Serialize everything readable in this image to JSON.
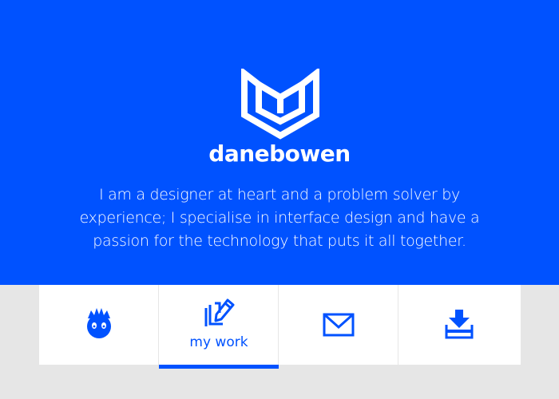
{
  "brand": {
    "name": "danebowen",
    "logo_icon": "open-book-shield-icon"
  },
  "hero": {
    "tagline": "I am a designer at heart and a problem solver by experience; I specialise in interface design and have a passion for the technology that puts it all together."
  },
  "nav": {
    "items": [
      {
        "icon": "mascot-face-icon",
        "label": "",
        "active": false
      },
      {
        "icon": "pen-edit-icon",
        "label": "my work",
        "active": true
      },
      {
        "icon": "envelope-icon",
        "label": "",
        "active": false
      },
      {
        "icon": "download-tray-icon",
        "label": "",
        "active": false
      }
    ]
  },
  "colors": {
    "primary": "#0052ff",
    "background": "#e6e6e6",
    "nav_background": "#ffffff",
    "text_on_primary": "#ffffff"
  }
}
